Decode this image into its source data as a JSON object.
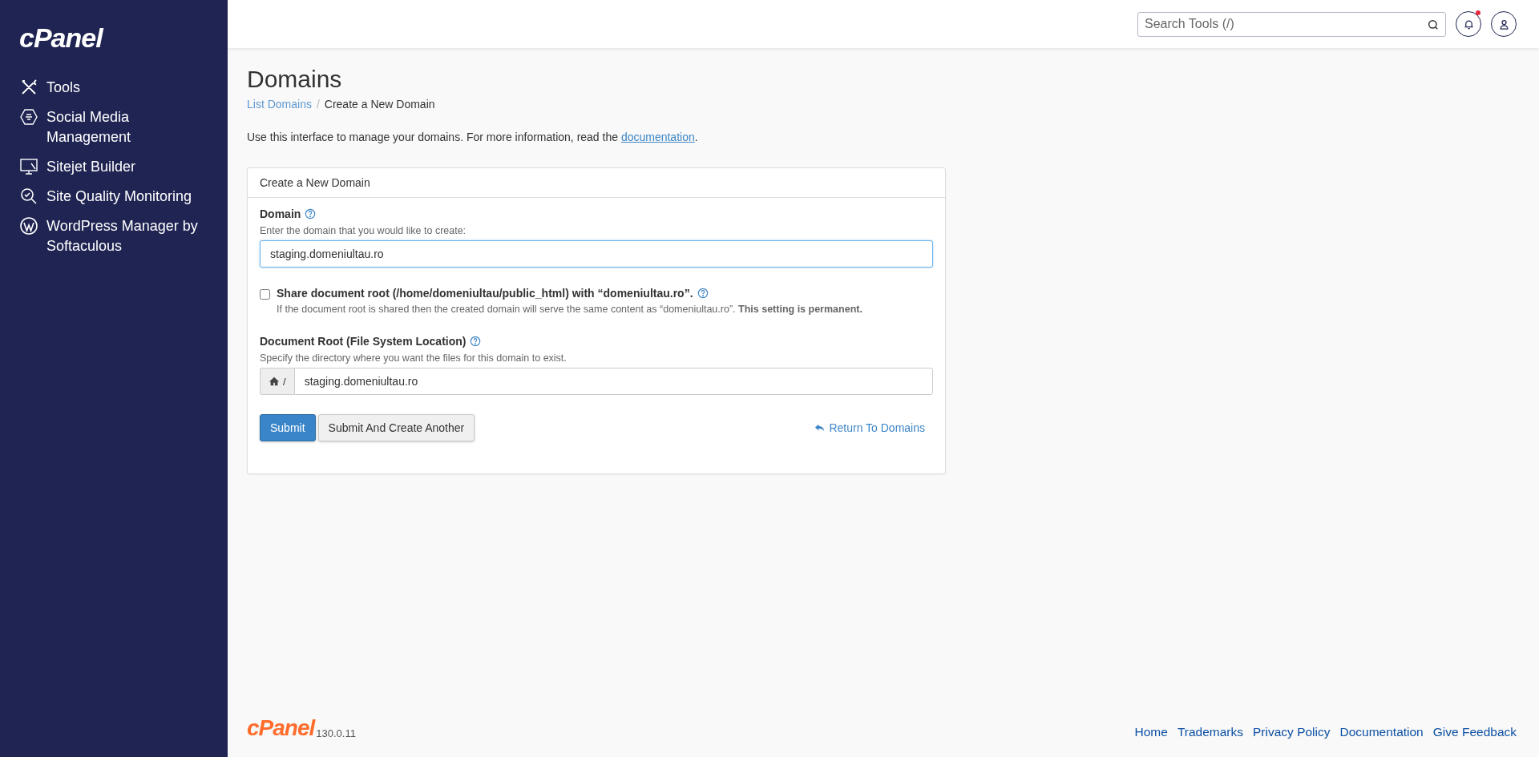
{
  "sidebar": {
    "logo": "cPanel",
    "items": [
      {
        "label": "Tools",
        "kind": "tools"
      },
      {
        "label": "Social Media Management",
        "kind": "social"
      },
      {
        "label": "Sitejet Builder",
        "kind": "builder"
      },
      {
        "label": "Site Quality Monitoring",
        "kind": "monitoring"
      },
      {
        "label": "WordPress Manager by Softaculous",
        "kind": "wordpress"
      }
    ]
  },
  "header": {
    "search": {
      "placeholder": "Search Tools (/)"
    },
    "notifications": {
      "unread": true
    }
  },
  "page": {
    "title": "Domains",
    "separator": "/",
    "breadcrumb": [
      {
        "label": "List Domains",
        "link": true
      },
      {
        "label": "Create a New Domain",
        "link": false
      }
    ],
    "intro": {
      "text": "Use this interface to manage your domains. For more information, read the ",
      "link": "documentation",
      "end": "."
    }
  },
  "panel": {
    "heading": "Create a New Domain",
    "domain": {
      "label": "Domain",
      "hint": "Enter the domain that you would like to create:",
      "value": "staging.domeniultau.ro",
      "focused": true
    },
    "share": {
      "label": "Share document root (/home/domeniultau/public_html) with “domeniultau.ro”.",
      "checked": false,
      "hint": "If the document root is shared then the created domain will serve the same content as “domeniultau.ro”. **This setting is permanent.**"
    },
    "docroot": {
      "label": "Document Root (File System Location)",
      "hint": "Specify the directory where you want the files for this domain to exist.",
      "prefix": "/",
      "value": "staging.domeniultau.ro"
    },
    "buttons": [
      {
        "label": "Submit",
        "kind": "primary"
      },
      {
        "label": "Submit And Create Another",
        "kind": "default"
      }
    ],
    "return_link": "Return To Domains"
  },
  "footer": {
    "logo": "cPanel",
    "version": "130.0.11",
    "links": [
      "Home",
      "Trademarks",
      "Privacy Policy",
      "Documentation",
      "Give Feedback"
    ]
  }
}
